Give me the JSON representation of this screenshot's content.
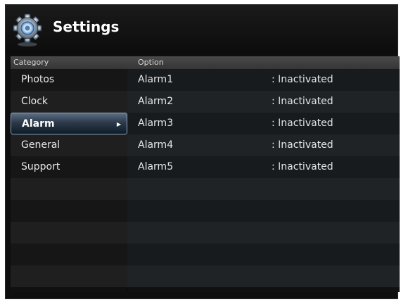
{
  "header": {
    "title": "Settings",
    "icon": "gear-icon"
  },
  "columns": {
    "category": "Category",
    "option": "Option"
  },
  "categories": [
    {
      "label": "Photos",
      "selected": false
    },
    {
      "label": "Clock",
      "selected": false
    },
    {
      "label": "Alarm",
      "selected": true
    },
    {
      "label": "General",
      "selected": false
    },
    {
      "label": "Support",
      "selected": false
    }
  ],
  "options": [
    {
      "name": "Alarm1",
      "status": ": Inactivated"
    },
    {
      "name": "Alarm2",
      "status": ": Inactivated"
    },
    {
      "name": "Alarm3",
      "status": ": Inactivated"
    },
    {
      "name": "Alarm4",
      "status": ": Inactivated"
    },
    {
      "name": "Alarm5",
      "status": ": Inactivated"
    }
  ],
  "colors": {
    "background": "#0e0e0e",
    "selection": "#2c3a4a",
    "text": "#e6e6e6"
  }
}
